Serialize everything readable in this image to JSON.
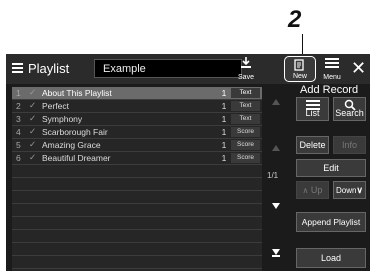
{
  "callout": "2",
  "header": {
    "title": "Playlist",
    "playlist_name": "Example",
    "save_label": "Save",
    "new_label": "New",
    "menu_label": "Menu",
    "close_label": "✕"
  },
  "rows": [
    {
      "num": "1",
      "check": "✓",
      "title": "About This Playlist",
      "count": "1",
      "type": "Text"
    },
    {
      "num": "2",
      "check": "✓",
      "title": "Perfect",
      "count": "1",
      "type": "Text"
    },
    {
      "num": "3",
      "check": "✓",
      "title": "Symphony",
      "count": "1",
      "type": "Text"
    },
    {
      "num": "4",
      "check": "✓",
      "title": "Scarborough Fair",
      "count": "1",
      "type": "Score"
    },
    {
      "num": "5",
      "check": "✓",
      "title": "Amazing Grace",
      "count": "1",
      "type": "Score"
    },
    {
      "num": "6",
      "check": "✓",
      "title": "Beautiful Dreamer",
      "count": "1",
      "type": "Score"
    }
  ],
  "page_indicator": "1/1",
  "side": {
    "add_record": "Add Record",
    "list": "List",
    "search": "Search",
    "delete": "Delete",
    "info": "Info",
    "edit": "Edit",
    "up": "Up",
    "down": "Down",
    "append_playlist": "Append Playlist",
    "load": "Load"
  }
}
